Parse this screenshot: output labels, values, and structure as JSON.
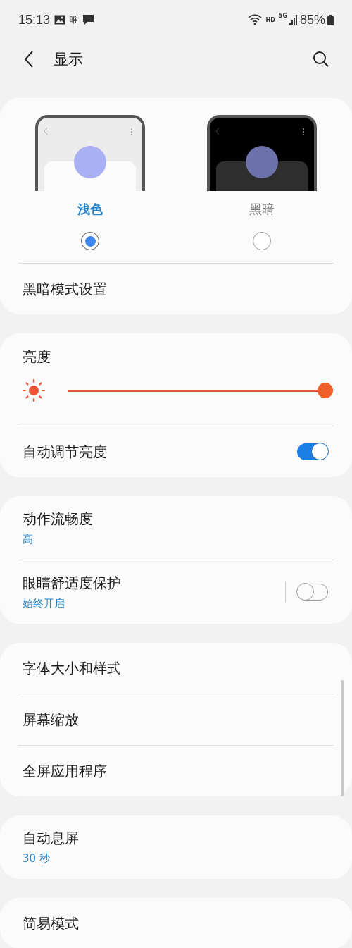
{
  "status_bar": {
    "time": "15:13",
    "notification_text": "唯",
    "network": "HD",
    "generation": "5G",
    "battery": "85%"
  },
  "header": {
    "title": "显示"
  },
  "sections": [
    {
      "items": [
        {
          "kind": "theme_picker",
          "options": [
            {
              "label": "浅色",
              "kind": "light",
              "selected": true
            },
            {
              "label": "黑暗",
              "kind": "dark",
              "selected": false
            }
          ]
        },
        {
          "kind": "row",
          "label": "黑暗模式设置"
        }
      ]
    },
    {
      "items": [
        {
          "kind": "slider",
          "label": "亮度",
          "level": 1.0
        },
        {
          "kind": "switch_row",
          "label": "自动调节亮度",
          "on": true
        }
      ]
    },
    {
      "items": [
        {
          "kind": "row",
          "label": "动作流畅度",
          "sub": "高"
        },
        {
          "kind": "switch_row",
          "label": "眼睛舒适度保护",
          "sub": "始终开启",
          "on": false,
          "separator": true
        }
      ]
    },
    {
      "items": [
        {
          "kind": "row",
          "label": "字体大小和样式"
        },
        {
          "kind": "row",
          "label": "屏幕缩放"
        },
        {
          "kind": "row",
          "label": "全屏应用程序"
        }
      ]
    },
    {
      "items": [
        {
          "kind": "row",
          "label": "自动息屏",
          "sub": "30 秒"
        }
      ]
    },
    {
      "items": [
        {
          "kind": "row",
          "label": "简易模式"
        }
      ]
    }
  ]
}
